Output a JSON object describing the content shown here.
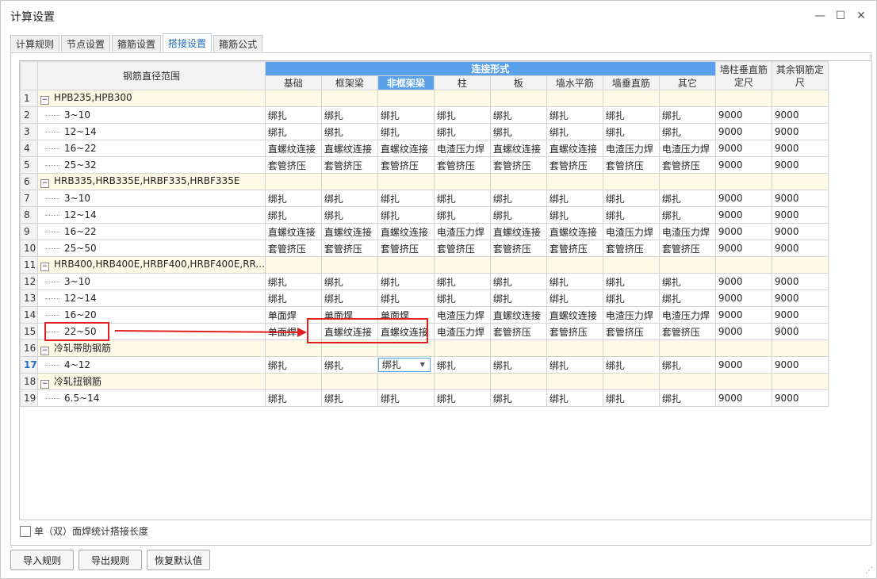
{
  "window": {
    "title": "计算设置"
  },
  "tabs": [
    {
      "label": "计算规则"
    },
    {
      "label": "节点设置"
    },
    {
      "label": "箍筋设置"
    },
    {
      "label": "搭接设置",
      "active": true
    },
    {
      "label": "箍筋公式"
    }
  ],
  "table": {
    "header_range": "钢筋直径范围",
    "header_group": "连接形式",
    "header_wall": "墙柱垂直筋定尺",
    "header_other": "其余钢筋定尺",
    "sub_headers": [
      "基础",
      "框架梁",
      "非框架梁",
      "柱",
      "板",
      "墙水平筋",
      "墙垂直筋",
      "其它"
    ],
    "highlight_sub": "非框架梁",
    "rows": [
      {
        "n": "1",
        "group": true,
        "label": "HPB235,HPB300"
      },
      {
        "n": "2",
        "label": "3~10",
        "cells": [
          "绑扎",
          "绑扎",
          "绑扎",
          "绑扎",
          "绑扎",
          "绑扎",
          "绑扎",
          "绑扎",
          "9000",
          "9000"
        ]
      },
      {
        "n": "3",
        "label": "12~14",
        "cells": [
          "绑扎",
          "绑扎",
          "绑扎",
          "绑扎",
          "绑扎",
          "绑扎",
          "绑扎",
          "绑扎",
          "9000",
          "9000"
        ]
      },
      {
        "n": "4",
        "label": "16~22",
        "cells": [
          "直螺纹连接",
          "直螺纹连接",
          "直螺纹连接",
          "电渣压力焊",
          "直螺纹连接",
          "直螺纹连接",
          "电渣压力焊",
          "电渣压力焊",
          "9000",
          "9000"
        ]
      },
      {
        "n": "5",
        "label": "25~32",
        "cells": [
          "套管挤压",
          "套管挤压",
          "套管挤压",
          "套管挤压",
          "套管挤压",
          "套管挤压",
          "套管挤压",
          "套管挤压",
          "9000",
          "9000"
        ]
      },
      {
        "n": "6",
        "group": true,
        "label": "HRB335,HRB335E,HRBF335,HRBF335E"
      },
      {
        "n": "7",
        "label": "3~10",
        "cells": [
          "绑扎",
          "绑扎",
          "绑扎",
          "绑扎",
          "绑扎",
          "绑扎",
          "绑扎",
          "绑扎",
          "9000",
          "9000"
        ]
      },
      {
        "n": "8",
        "label": "12~14",
        "cells": [
          "绑扎",
          "绑扎",
          "绑扎",
          "绑扎",
          "绑扎",
          "绑扎",
          "绑扎",
          "绑扎",
          "9000",
          "9000"
        ]
      },
      {
        "n": "9",
        "label": "16~22",
        "cells": [
          "直螺纹连接",
          "直螺纹连接",
          "直螺纹连接",
          "电渣压力焊",
          "直螺纹连接",
          "直螺纹连接",
          "电渣压力焊",
          "电渣压力焊",
          "9000",
          "9000"
        ]
      },
      {
        "n": "10",
        "label": "25~50",
        "cells": [
          "套管挤压",
          "套管挤压",
          "套管挤压",
          "套管挤压",
          "套管挤压",
          "套管挤压",
          "套管挤压",
          "套管挤压",
          "9000",
          "9000"
        ]
      },
      {
        "n": "11",
        "group": true,
        "label": "HRB400,HRB400E,HRBF400,HRBF400E,RR..."
      },
      {
        "n": "12",
        "label": "3~10",
        "cells": [
          "绑扎",
          "绑扎",
          "绑扎",
          "绑扎",
          "绑扎",
          "绑扎",
          "绑扎",
          "绑扎",
          "9000",
          "9000"
        ]
      },
      {
        "n": "13",
        "label": "12~14",
        "cells": [
          "绑扎",
          "绑扎",
          "绑扎",
          "绑扎",
          "绑扎",
          "绑扎",
          "绑扎",
          "绑扎",
          "9000",
          "9000"
        ]
      },
      {
        "n": "14",
        "label": "16~20",
        "cells": [
          "单面焊",
          "单面焊",
          "单面焊",
          "电渣压力焊",
          "直螺纹连接",
          "直螺纹连接",
          "电渣压力焊",
          "电渣压力焊",
          "9000",
          "9000"
        ]
      },
      {
        "n": "15",
        "label": "22~50",
        "cells": [
          "单面焊",
          "直螺纹连接",
          "直螺纹连接",
          "电渣压力焊",
          "套管挤压",
          "套管挤压",
          "套管挤压",
          "套管挤压",
          "9000",
          "9000"
        ]
      },
      {
        "n": "16",
        "group": true,
        "label": "冷轧带肋钢筋"
      },
      {
        "n": "17",
        "label": "4~12",
        "active": true,
        "cells": [
          "绑扎",
          "绑扎",
          "绑扎",
          "绑扎",
          "绑扎",
          "绑扎",
          "绑扎",
          "绑扎",
          "9000",
          "9000"
        ]
      },
      {
        "n": "18",
        "group": true,
        "label": "冷轧扭钢筋"
      },
      {
        "n": "19",
        "label": "6.5~14",
        "cells": [
          "绑扎",
          "绑扎",
          "绑扎",
          "绑扎",
          "绑扎",
          "绑扎",
          "绑扎",
          "绑扎",
          "9000",
          "9000"
        ]
      }
    ]
  },
  "checkbox": {
    "label": "单（双）面焊统计搭接长度"
  },
  "buttons": {
    "import": "导入规则",
    "export": "导出规则",
    "restore": "恢复默认值"
  },
  "colors": {
    "header_blue": "#5aa0ea",
    "group_row": "#fdfbe5",
    "annotation_red": "#e02020"
  }
}
